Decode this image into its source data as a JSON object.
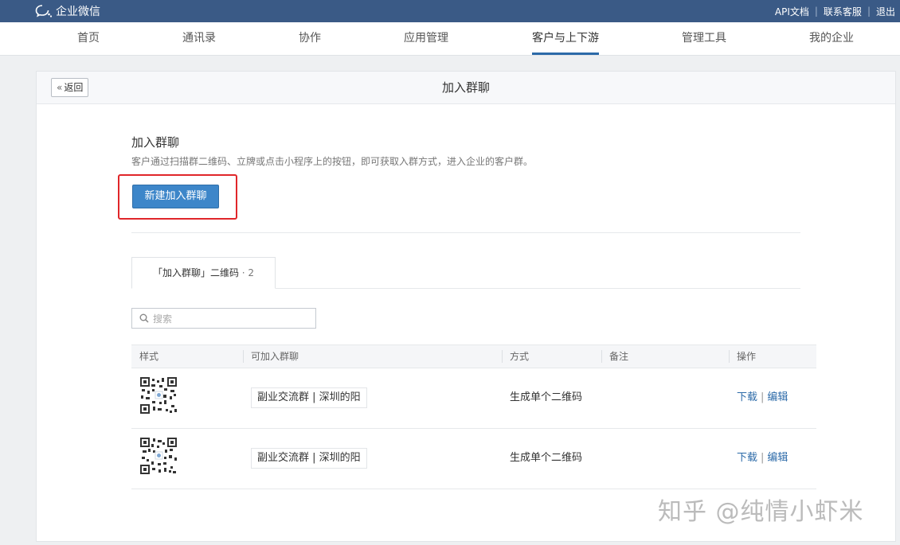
{
  "topbar": {
    "brand": "企业微信",
    "links": [
      "API文档",
      "联系客服",
      "退出"
    ]
  },
  "nav": {
    "items": [
      "首页",
      "通讯录",
      "协作",
      "应用管理",
      "客户与上下游",
      "管理工具",
      "我的企业"
    ],
    "active": "客户与上下游"
  },
  "panel": {
    "back_label": "返回",
    "title": "加入群聊"
  },
  "section": {
    "title": "加入群聊",
    "description": "客户通过扫描群二维码、立牌或点击小程序上的按钮，即可获取入群方式，进入企业的客户群。",
    "new_button": "新建加入群聊"
  },
  "tab": {
    "label": "「加入群聊」二维码",
    "count": "· 2"
  },
  "search": {
    "placeholder": "搜索",
    "value": ""
  },
  "table": {
    "headers": [
      "样式",
      "可加入群聊",
      "方式",
      "备注",
      "操作"
    ],
    "rows": [
      {
        "group": "副业交流群 | 深圳的阳",
        "method": "生成单个二维码",
        "note": "",
        "download": "下载",
        "edit": "编辑"
      },
      {
        "group": "副业交流群 | 深圳的阳",
        "method": "生成单个二维码",
        "note": "",
        "download": "下载",
        "edit": "编辑"
      }
    ]
  },
  "watermark": "知乎 @纯情小虾米",
  "colors": {
    "topbar": "#3a5a86",
    "primary": "#3d86c9",
    "link": "#2c6aa8",
    "highlight": "#e0262a"
  },
  "icons": [
    "wecom-logo-icon",
    "double-chevron-left-icon",
    "search-icon",
    "qr-code-icon"
  ]
}
